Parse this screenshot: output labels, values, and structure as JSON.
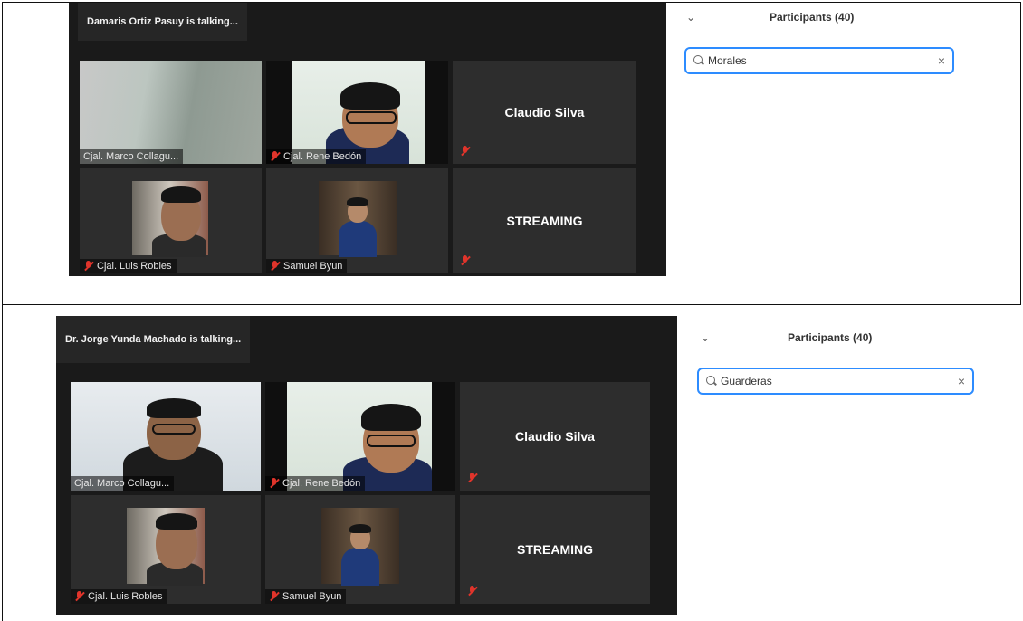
{
  "screenshot_1": {
    "talking_banner": "Damaris Ortiz Pasuy is talking...",
    "tiles": [
      {
        "name": "Cjal. Marco Collagu...",
        "muted": false
      },
      {
        "name": "Cjal. Rene Bedón",
        "muted": true
      },
      {
        "name": "Claudio Silva",
        "muted": true
      },
      {
        "name": "Cjal. Luis Robles",
        "muted": true
      },
      {
        "name": "Samuel Byun",
        "muted": true
      },
      {
        "name": "STREAMING",
        "muted": true
      }
    ],
    "participants": {
      "title": "Participants (40)",
      "search_value": "Morales"
    }
  },
  "screenshot_2": {
    "talking_banner": "Dr. Jorge Yunda Machado is talking...",
    "tiles": [
      {
        "name": "Cjal. Marco Collagu...",
        "muted": false
      },
      {
        "name": "Cjal. Rene Bedón",
        "muted": true
      },
      {
        "name": "Claudio Silva",
        "muted": true
      },
      {
        "name": "Cjal. Luis Robles",
        "muted": true
      },
      {
        "name": "Samuel Byun",
        "muted": true
      },
      {
        "name": "STREAMING",
        "muted": true
      }
    ],
    "participants": {
      "title": "Participants (40)",
      "search_value": "Guarderas"
    }
  },
  "icons": {
    "collapse": "chevron-down-icon",
    "search": "search-icon",
    "clear": "close-icon",
    "mute": "mic-muted-icon"
  },
  "colors": {
    "meeting_background": "#1a1a1a",
    "tile_background": "#2d2d2d",
    "search_focus": "#2d8cff",
    "mute_red": "#e0342b"
  }
}
